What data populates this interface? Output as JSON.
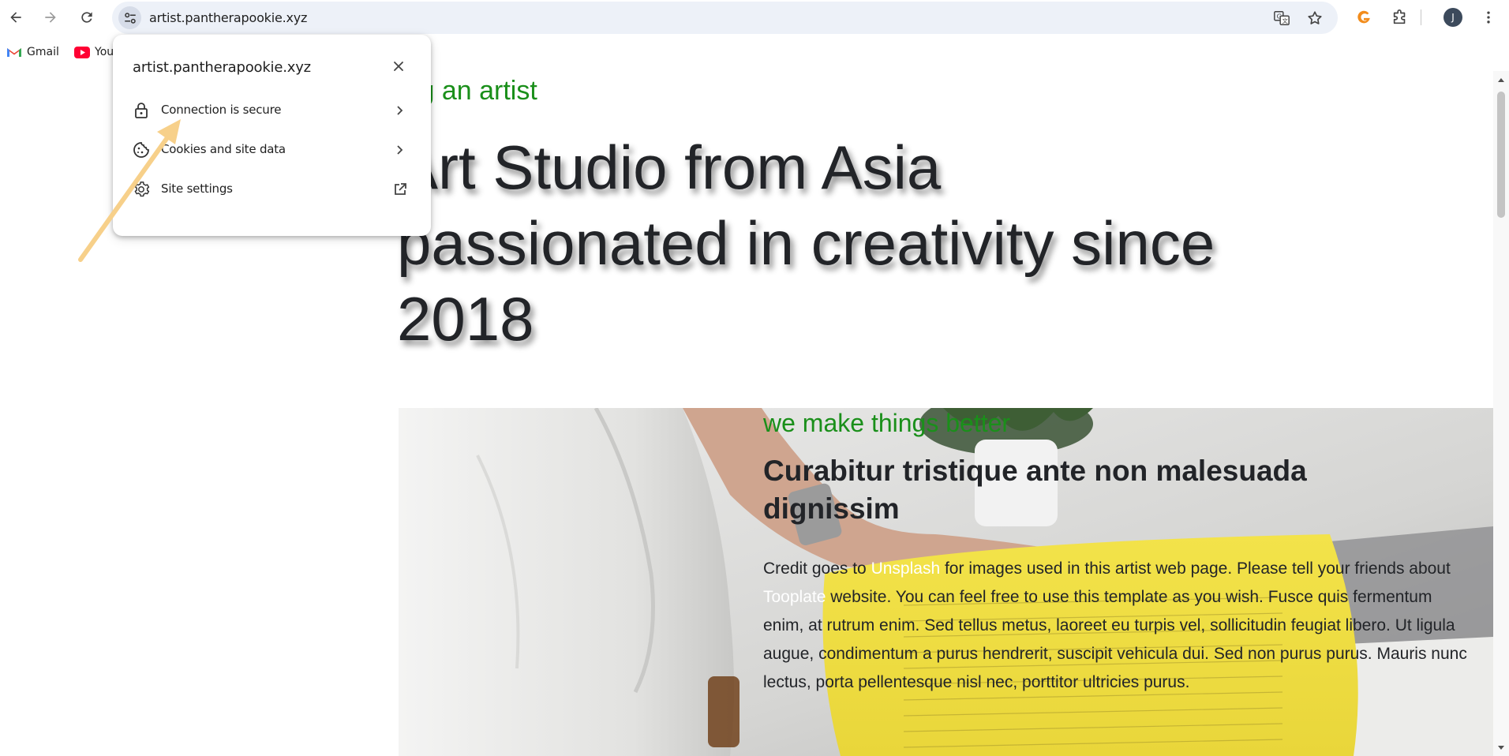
{
  "browser": {
    "url": "artist.pantherapookie.xyz",
    "profile_initial": "J",
    "bookmarks": [
      {
        "label": "Gmail",
        "icon": "gmail-icon"
      },
      {
        "label": "You",
        "icon": "youtube-icon"
      }
    ]
  },
  "popup": {
    "title": "artist.pantherapookie.xyz",
    "items": [
      {
        "label": "Connection is secure",
        "icon": "lock-icon",
        "trail": "chevron-right-icon"
      },
      {
        "label": "Cookies and site data",
        "icon": "cookie-icon",
        "trail": "chevron-right-icon"
      },
      {
        "label": "Site settings",
        "icon": "gear-icon",
        "trail": "external-link-icon"
      }
    ]
  },
  "page": {
    "tagline": "ing an artist",
    "hero_line1": "Art Studio from Asia",
    "hero_line2": "passionated in creativity since",
    "hero_line3": "2018",
    "feature": {
      "subtitle": "we make things better",
      "heading": "Curabitur tristique ante non malesuada dignissim",
      "body_1": "Credit goes to ",
      "link_1": "Unsplash",
      "body_2": " for images used in this artist web page. Please tell your friends about ",
      "link_2": "Tooplate",
      "body_3": " website. You can feel free to use this template as you wish. Fusce quis fermentum enim, at rutrum enim. Sed tellus metus, laoreet eu turpis vel, sollicitudin feugiat libero. Ut ligula augue, condimentum a purus hendrerit, suscipit vehicula dui. Sed non purus purus. Mauris nunc lectus, porta pellentesque nisl nec, porttitor ultricies purus."
    }
  },
  "colors": {
    "accent_green": "#1a8f1a",
    "text_dark": "#222428",
    "annotation_arrow": "#f7d08a"
  }
}
